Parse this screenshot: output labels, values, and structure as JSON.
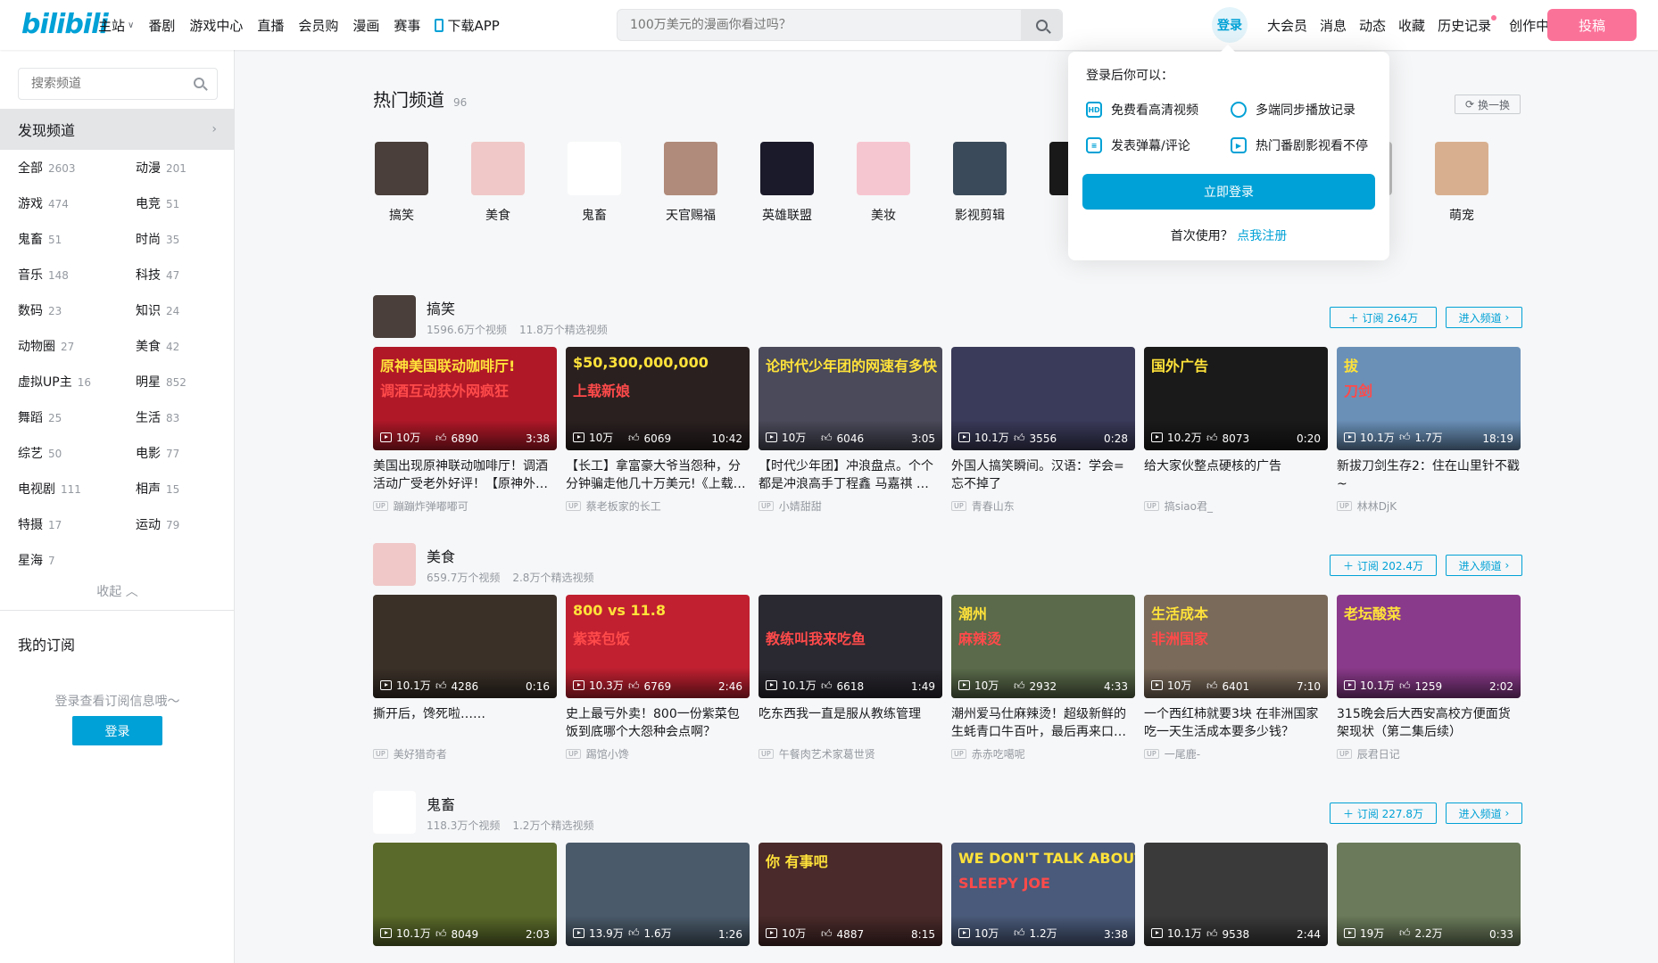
{
  "header": {
    "logo": "bilibili",
    "nav": [
      "主站",
      "番剧",
      "游戏中心",
      "直播",
      "会员购",
      "漫画",
      "赛事",
      "下载APP"
    ],
    "search_placeholder": "100万美元的漫画你看过吗？",
    "login": "登录",
    "user_nav": [
      "大会员",
      "消息",
      "动态",
      "收藏",
      "历史记录",
      "创作中心"
    ],
    "upload": "投稿",
    "colors": {
      "brand": "#00a1d6",
      "pink": "#fb7299"
    }
  },
  "sidebar": {
    "search_placeholder": "搜索频道",
    "discover": "发现频道",
    "categories": [
      {
        "name": "全部",
        "count": "2603"
      },
      {
        "name": "动漫",
        "count": "201"
      },
      {
        "name": "游戏",
        "count": "474"
      },
      {
        "name": "电竞",
        "count": "51"
      },
      {
        "name": "鬼畜",
        "count": "51"
      },
      {
        "name": "时尚",
        "count": "35"
      },
      {
        "name": "音乐",
        "count": "148"
      },
      {
        "name": "科技",
        "count": "47"
      },
      {
        "name": "数码",
        "count": "23"
      },
      {
        "name": "知识",
        "count": "24"
      },
      {
        "name": "动物圈",
        "count": "27"
      },
      {
        "name": "美食",
        "count": "42"
      },
      {
        "name": "虚拟UP主",
        "count": "16"
      },
      {
        "name": "明星",
        "count": "852"
      },
      {
        "name": "舞蹈",
        "count": "25"
      },
      {
        "name": "生活",
        "count": "83"
      },
      {
        "name": "综艺",
        "count": "50"
      },
      {
        "name": "电影",
        "count": "77"
      },
      {
        "name": "电视剧",
        "count": "111"
      },
      {
        "name": "相声",
        "count": "15"
      },
      {
        "name": "特摄",
        "count": "17"
      },
      {
        "name": "运动",
        "count": "79"
      },
      {
        "name": "星海",
        "count": "7"
      }
    ],
    "collapse": "收起",
    "my_sub": "我的订阅",
    "sub_hint": "登录查看订阅信息哦～",
    "login": "登录"
  },
  "hot": {
    "title": "热门频道",
    "count": "96",
    "swap": "换一换",
    "channels": [
      "搞笑",
      "美食",
      "鬼畜",
      "天官赐福",
      "英雄联盟",
      "美妆",
      "影视剪辑",
      "",
      "",
      "",
      "",
      "萌宠"
    ]
  },
  "popup": {
    "head": "登录后你可以：",
    "features": [
      "免费看高清视频",
      "多端同步播放记录",
      "发表弹幕/评论",
      "热门番剧影视看不停"
    ],
    "button": "立即登录",
    "first": "首次使用？",
    "register": "点我注册"
  },
  "sections": [
    {
      "name": "搞笑",
      "videos_count": "1596.6万个视频",
      "featured": "11.8万个精选视频",
      "subscribe": "订阅 264万",
      "enter": "进入频道",
      "cards": [
        {
          "plays": "10万",
          "likes": "6890",
          "dur": "3:38",
          "title": "美国出现原神联动咖啡厅！调酒活动广受老外好评！【原神外…",
          "up": "蹦蹦炸弹嘟嘟可",
          "text": "原神美国联动咖啡厅!",
          "text2": "调酒互动获外网疯狂"
        },
        {
          "plays": "10万",
          "likes": "6069",
          "dur": "10:42",
          "title": "【长工】拿富豪大爷当怨种，分分钟骗走他几十万美元!《上载…",
          "up": "蔡老板家的长工",
          "text": "$50,300,000,000",
          "text2": "上载新娘"
        },
        {
          "plays": "10万",
          "likes": "6046",
          "dur": "3:05",
          "title": "【时代少年团】冲浪盘点。个个都是冲浪高手丁程鑫 马嘉祺 …",
          "up": "小婧甜甜",
          "text": "论时代少年团的网速有多快",
          "text2": ""
        },
        {
          "plays": "10.1万",
          "likes": "3556",
          "dur": "0:28",
          "title": "外国人搞笑瞬间。汉语：学会=忘不掉了",
          "up": "青春山东",
          "text": "",
          "text2": ""
        },
        {
          "plays": "10.2万",
          "likes": "8073",
          "dur": "0:20",
          "title": "给大家伙整点硬核的广告",
          "up": "搞siao君_",
          "text": "国外广告",
          "text2": ""
        },
        {
          "plays": "10.1万",
          "likes": "1.7万",
          "dur": "18:19",
          "title": "新拔刀剑生存2：住在山里针不戳~",
          "up": "林林DjK",
          "text": "拔",
          "text2": "刀剑"
        }
      ]
    },
    {
      "name": "美食",
      "videos_count": "659.7万个视频",
      "featured": "2.8万个精选视频",
      "subscribe": "订阅 202.4万",
      "enter": "进入频道",
      "cards": [
        {
          "plays": "10.1万",
          "likes": "4286",
          "dur": "0:16",
          "title": "撕开后，馋死啦……",
          "up": "美好猎奇者",
          "text": "",
          "text2": ""
        },
        {
          "plays": "10.3万",
          "likes": "6769",
          "dur": "2:46",
          "title": "史上最亏外卖！800一份紫菜包饭到底哪个大怨种会点啊？",
          "up": "踢馆小馋",
          "text": "800 vs 11.8",
          "text2": "紫菜包饭"
        },
        {
          "plays": "10.1万",
          "likes": "6618",
          "dur": "1:49",
          "title": "吃东西我一直是服从教练管理",
          "up": "午餐肉艺术家葛世贤",
          "text": "",
          "text2": "教练叫我来吃鱼"
        },
        {
          "plays": "10万",
          "likes": "2932",
          "dur": "4:33",
          "title": "潮州爱马仕麻辣烫！超级新鲜的生蚝青口牛百叶，最后再来口…",
          "up": "赤赤吃噶呢",
          "text": "潮州",
          "text2": "麻辣烫"
        },
        {
          "plays": "10万",
          "likes": "6401",
          "dur": "7:10",
          "title": "一个西红柿就要3块 在非洲国家吃一天生活成本要多少钱？",
          "up": "一尾鹿-",
          "text": "生活成本",
          "text2": "非洲国家"
        },
        {
          "plays": "10.1万",
          "likes": "1259",
          "dur": "2:02",
          "title": "315晚会后大西安高校方便面货架现状（第二集后续）",
          "up": "辰君日记",
          "text": "老坛酸菜",
          "text2": ""
        }
      ]
    },
    {
      "name": "鬼畜",
      "videos_count": "118.3万个视频",
      "featured": "1.2万个精选视频",
      "subscribe": "订阅 227.8万",
      "enter": "进入频道",
      "cards": [
        {
          "plays": "10.1万",
          "likes": "8049",
          "dur": "2:03",
          "title": "",
          "up": "",
          "text": "",
          "text2": ""
        },
        {
          "plays": "13.9万",
          "likes": "1.6万",
          "dur": "1:26",
          "title": "",
          "up": "",
          "text": "",
          "text2": ""
        },
        {
          "plays": "10万",
          "likes": "4887",
          "dur": "8:15",
          "title": "",
          "up": "",
          "text": "你 有事吧",
          "text2": ""
        },
        {
          "plays": "10万",
          "likes": "1.2万",
          "dur": "3:38",
          "title": "",
          "up": "",
          "text": "WE DON'T TALK ABOUT",
          "text2": "SLEEPY JOE"
        },
        {
          "plays": "10.1万",
          "likes": "9538",
          "dur": "2:44",
          "title": "",
          "up": "",
          "text": "",
          "text2": ""
        },
        {
          "plays": "19万",
          "likes": "2.2万",
          "dur": "0:33",
          "title": "",
          "up": "",
          "text": "",
          "text2": ""
        }
      ]
    }
  ]
}
